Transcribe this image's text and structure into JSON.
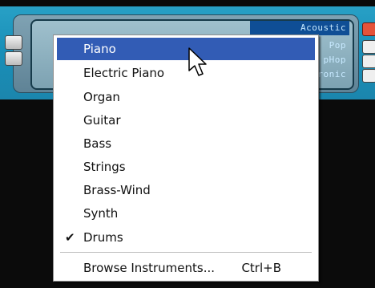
{
  "device": {
    "categories": [
      "Acoustic",
      "Pop",
      "pHop",
      "ronic"
    ]
  },
  "menu": {
    "items": [
      {
        "label": "Piano",
        "selected": true,
        "checked": false
      },
      {
        "label": "Electric Piano",
        "selected": false,
        "checked": false
      },
      {
        "label": "Organ",
        "selected": false,
        "checked": false
      },
      {
        "label": "Guitar",
        "selected": false,
        "checked": false
      },
      {
        "label": "Bass",
        "selected": false,
        "checked": false
      },
      {
        "label": "Strings",
        "selected": false,
        "checked": false
      },
      {
        "label": "Brass-Wind",
        "selected": false,
        "checked": false
      },
      {
        "label": "Synth",
        "selected": false,
        "checked": false
      },
      {
        "label": "Drums",
        "selected": false,
        "checked": true
      }
    ],
    "browse": {
      "label": "Browse Instruments...",
      "shortcut": "Ctrl+B"
    },
    "check_glyph": "✔"
  },
  "colors": {
    "highlight": "#325cb5",
    "frame": "#1a8fb8",
    "category_highlight": "#0f4e95"
  },
  "icons": {
    "cursor": "arrow-pointer-icon",
    "check": "checkmark-icon"
  }
}
